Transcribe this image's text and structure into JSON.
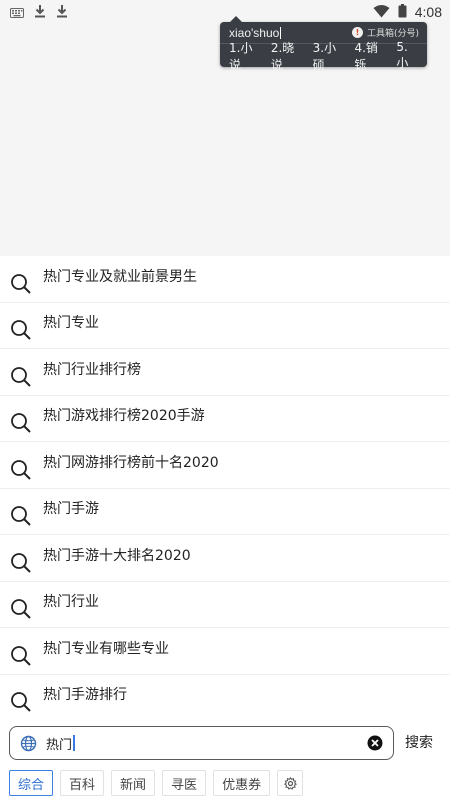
{
  "status_bar": {
    "time": "4:08",
    "icons": [
      "keyboard-icon",
      "download-icon",
      "download-icon",
      "wifi-icon",
      "battery-icon"
    ]
  },
  "ime_popup": {
    "pinyin": "xiao'shuo",
    "toolbox_label": "工具箱(分号)",
    "candidates": [
      "1.小说",
      "2.晓说",
      "3.小硕",
      "4.销铄",
      "5.小"
    ]
  },
  "suggestions": [
    "热门专业及就业前景男生",
    "热门专业",
    "热门行业排行榜",
    "热门游戏排行榜2020手游",
    "热门网游排行榜前十名2020",
    "热门手游",
    "热门手游十大排名2020",
    "热门行业",
    "热门专业有哪些专业",
    "热门手游排行"
  ],
  "search": {
    "query": "热门",
    "button_label": "搜索"
  },
  "tabs": [
    "综合",
    "百科",
    "新闻",
    "寻医",
    "优惠券"
  ],
  "colors": {
    "accent": "#3b82e0",
    "ime_bg": "#3a3e44",
    "background": "#f5f5f5"
  }
}
